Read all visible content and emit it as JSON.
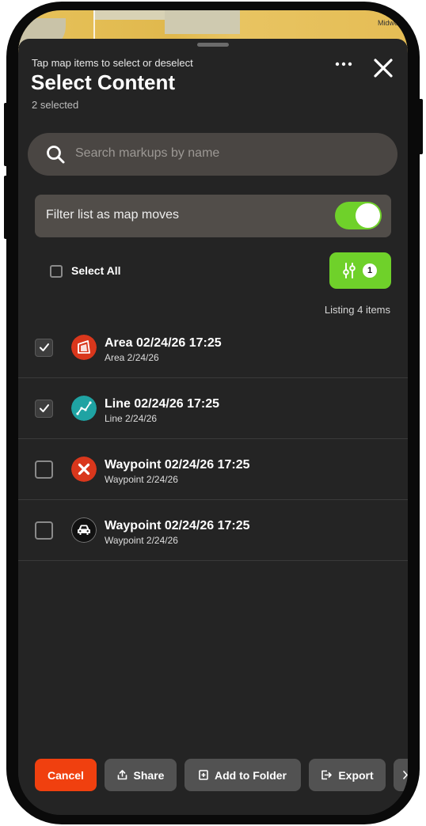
{
  "map": {
    "town_label": "Midwe"
  },
  "header": {
    "hint": "Tap map items to select or deselect",
    "title": "Select Content",
    "selected_count": "2 selected",
    "more_label": "•••"
  },
  "search": {
    "placeholder": "Search markups by name"
  },
  "filter_toggle": {
    "label": "Filter list as map moves",
    "on": true
  },
  "select_all": {
    "label": "Select All",
    "checked": false
  },
  "filter_button": {
    "badge": "1"
  },
  "listing": "Listing 4 items",
  "items": [
    {
      "name": "Area 02/24/26 17:25",
      "subtitle": "Area 2/24/26",
      "checked": true,
      "icon": "area-icon",
      "icon_color": "#d9371c"
    },
    {
      "name": "Line 02/24/26 17:25",
      "subtitle": "Line 2/24/26",
      "checked": true,
      "icon": "line-icon",
      "icon_color": "#1fa3a3"
    },
    {
      "name": "Waypoint 02/24/26 17:25",
      "subtitle": "Waypoint 2/24/26",
      "checked": false,
      "icon": "x-mark-icon",
      "icon_color": "#d9371c"
    },
    {
      "name": "Waypoint 02/24/26 17:25",
      "subtitle": "Waypoint 2/24/26",
      "checked": false,
      "icon": "car-icon",
      "icon_color": "#111111"
    }
  ],
  "actions": {
    "cancel": "Cancel",
    "share": "Share",
    "add_to_folder": "Add to Folder",
    "export": "Export"
  },
  "colors": {
    "accent_green": "#6fd12a",
    "cancel_red": "#f0400f",
    "sheet_bg": "#242424"
  }
}
